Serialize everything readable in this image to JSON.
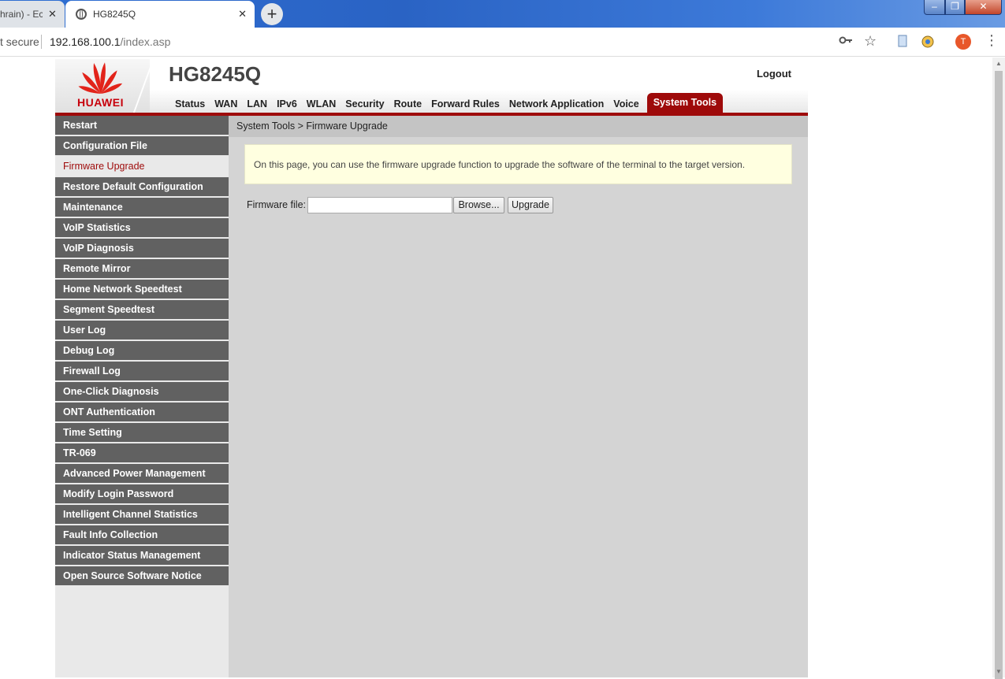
{
  "browser": {
    "tabs": [
      {
        "title": "hrain) - Ec",
        "close": "✕"
      },
      {
        "title": "HG8245Q",
        "close": "✕"
      }
    ],
    "new_tab": "+",
    "window_controls": {
      "min": "–",
      "max": "❐",
      "close": "✕"
    },
    "security": "t secure",
    "url_host": "192.168.100.1",
    "url_path": "/index.asp",
    "avatar_letter": "T",
    "icons": [
      "key-icon",
      "star-icon",
      "bookmark-icon",
      "extension-icon",
      "menu-icon"
    ]
  },
  "header": {
    "logo_text": "HUAWEI",
    "model": "HG8245Q",
    "logout": "Logout"
  },
  "nav": [
    {
      "label": "Status"
    },
    {
      "label": "WAN"
    },
    {
      "label": "LAN"
    },
    {
      "label": "IPv6"
    },
    {
      "label": "WLAN"
    },
    {
      "label": "Security"
    },
    {
      "label": "Route"
    },
    {
      "label": "Forward Rules"
    },
    {
      "label": "Network Application"
    },
    {
      "label": "Voice"
    },
    {
      "label": "System Tools",
      "active": true
    }
  ],
  "sidebar": [
    {
      "label": "Restart"
    },
    {
      "label": "Configuration File"
    },
    {
      "label": "Firmware Upgrade",
      "active": true
    },
    {
      "label": "Restore Default Configuration"
    },
    {
      "label": "Maintenance"
    },
    {
      "label": "VoIP Statistics"
    },
    {
      "label": "VoIP Diagnosis"
    },
    {
      "label": "Remote Mirror"
    },
    {
      "label": "Home Network Speedtest"
    },
    {
      "label": "Segment Speedtest"
    },
    {
      "label": "User Log"
    },
    {
      "label": "Debug Log"
    },
    {
      "label": "Firewall Log"
    },
    {
      "label": "One-Click Diagnosis"
    },
    {
      "label": "ONT Authentication"
    },
    {
      "label": "Time Setting"
    },
    {
      "label": "TR-069"
    },
    {
      "label": "Advanced Power Management"
    },
    {
      "label": "Modify Login Password"
    },
    {
      "label": "Intelligent Channel Statistics"
    },
    {
      "label": "Fault Info Collection"
    },
    {
      "label": "Indicator Status Management"
    },
    {
      "label": "Open Source Software Notice"
    }
  ],
  "main": {
    "breadcrumb": "System Tools > Firmware Upgrade",
    "info": "On this page, you can use the firmware upgrade function to upgrade the software of the terminal to the target version.",
    "firmware_label": "Firmware file:",
    "firmware_value": "",
    "browse_label": "Browse...",
    "upgrade_label": "Upgrade"
  },
  "colors": {
    "accent": "#9e0a0a",
    "sidebar_bg": "#616161",
    "logo_red": "#c7000b",
    "info_bg": "#ffffe0"
  }
}
